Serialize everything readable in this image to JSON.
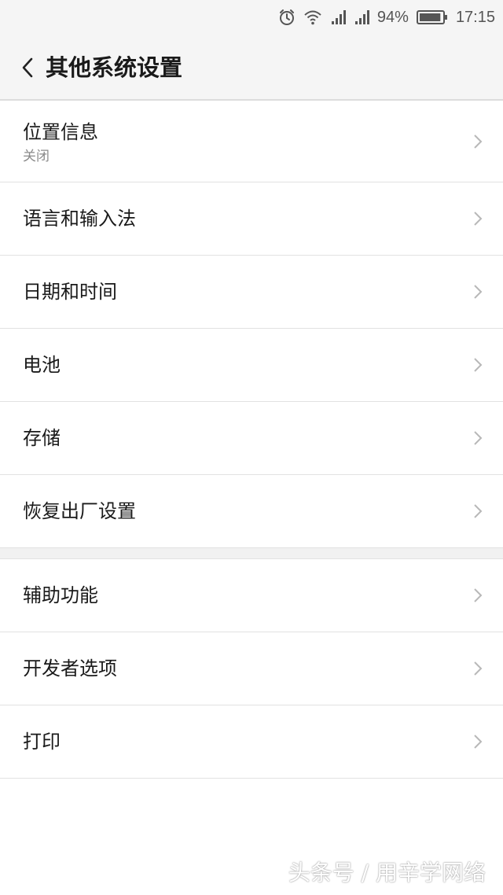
{
  "status_bar": {
    "battery_percent": "94%",
    "battery_level": 0.94,
    "time": "17:15",
    "icons": [
      "alarm-icon",
      "wifi-icon",
      "signal-icon",
      "signal-icon",
      "battery-icon"
    ]
  },
  "header": {
    "title": "其他系统设置",
    "back_icon": "chevron-left-icon"
  },
  "group1": {
    "items": [
      {
        "label": "位置信息",
        "sub": "关闭"
      },
      {
        "label": "语言和输入法"
      },
      {
        "label": "日期和时间"
      },
      {
        "label": "电池"
      },
      {
        "label": "存储"
      },
      {
        "label": "恢复出厂设置"
      }
    ]
  },
  "group2": {
    "items": [
      {
        "label": "辅助功能"
      },
      {
        "label": "开发者选项"
      },
      {
        "label": "打印"
      }
    ]
  },
  "watermark": "头条号 / 用辛学网络",
  "colors": {
    "bar_background": "#f5f5f5",
    "divider": "#e2e2e2",
    "chevron": "#b8b8b8",
    "secondary_text": "#8a8a8a"
  }
}
